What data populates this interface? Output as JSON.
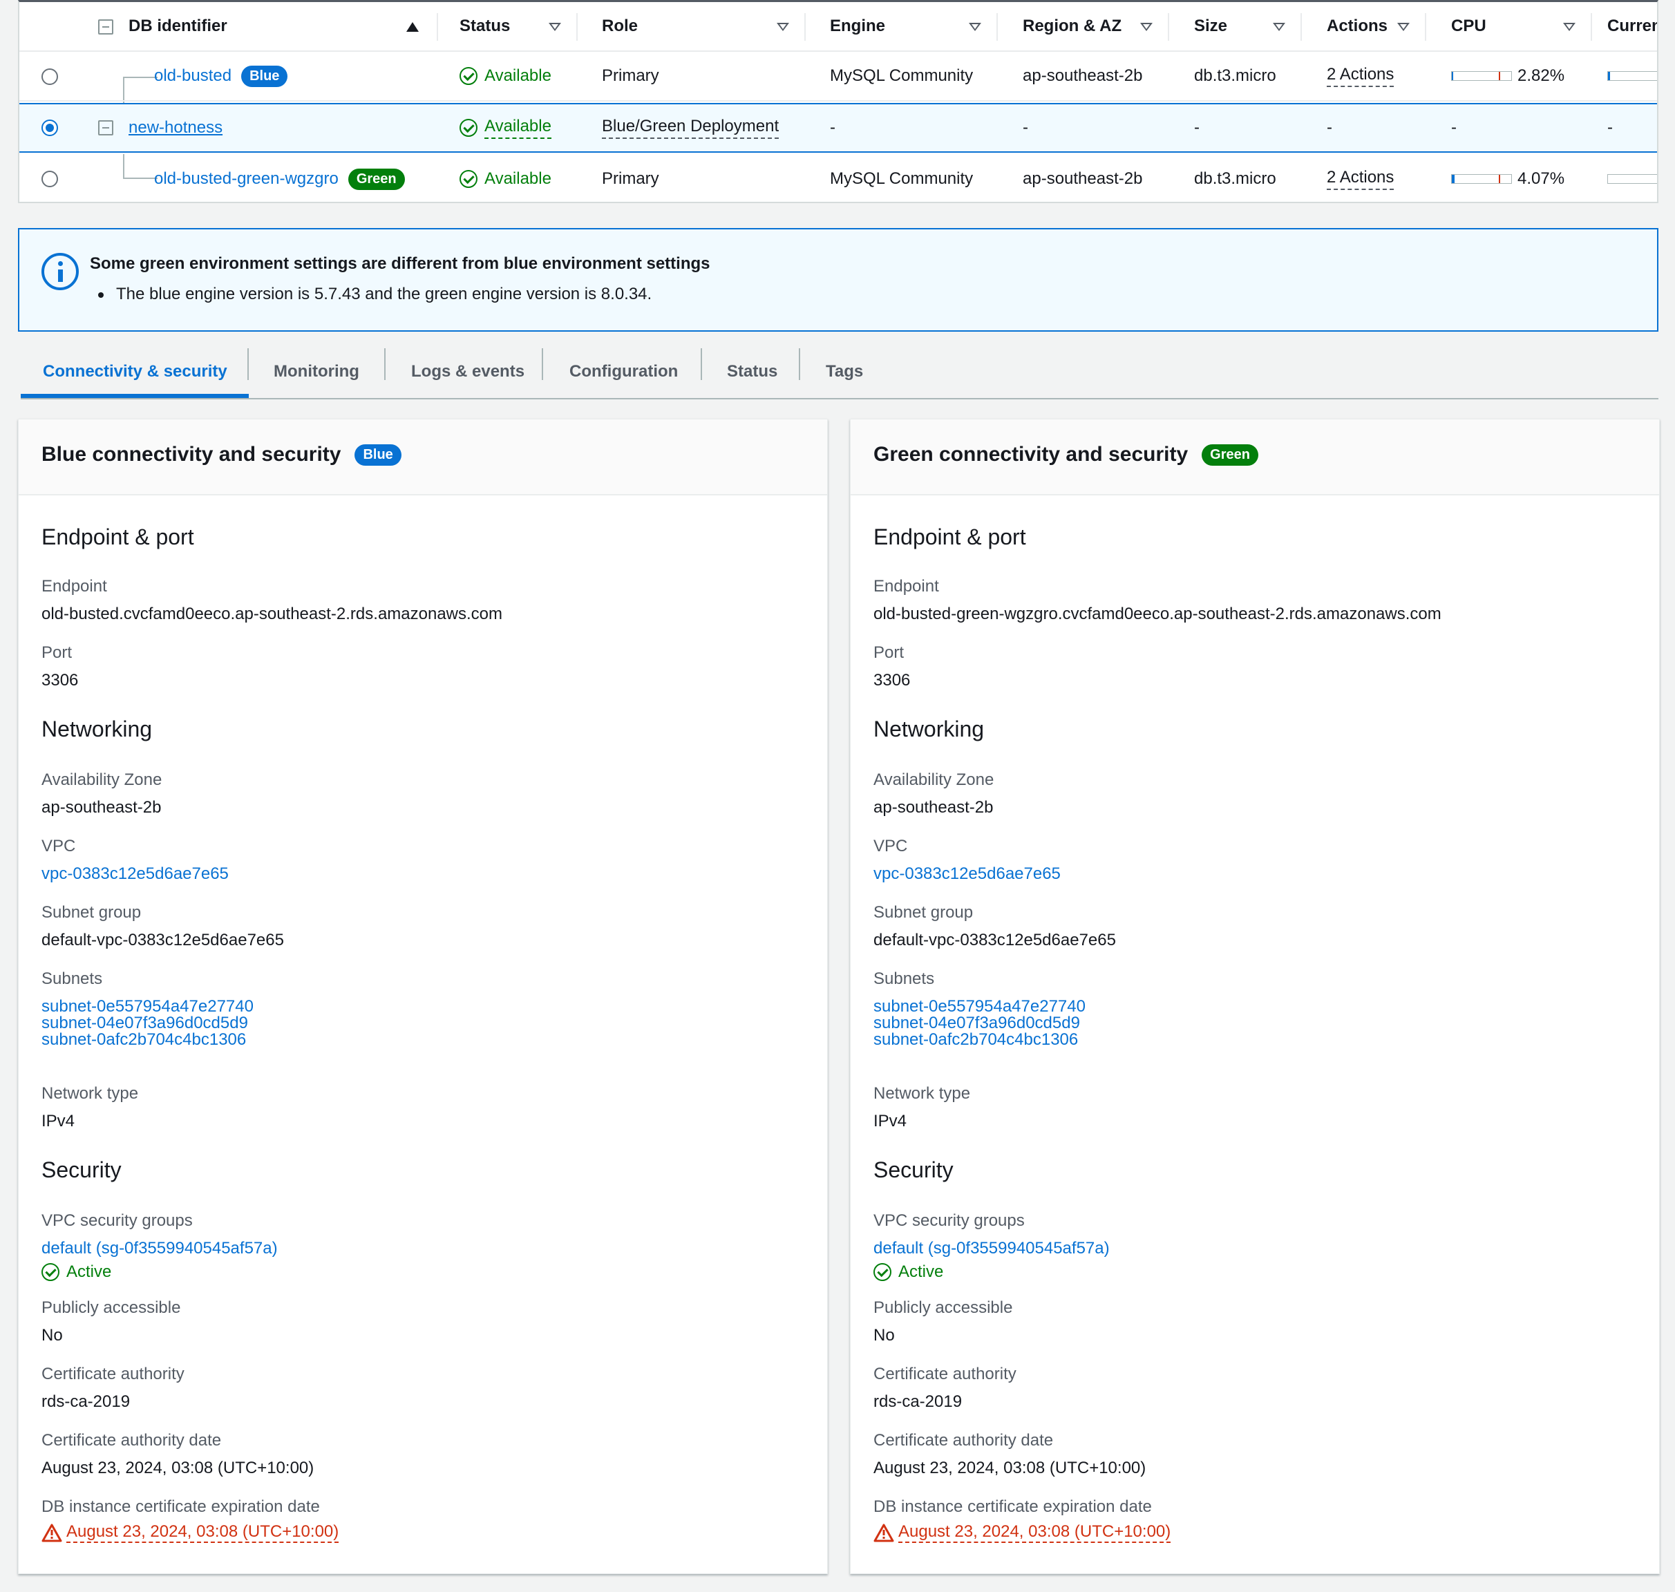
{
  "table": {
    "headers": {
      "db_identifier": "DB identifier",
      "status": "Status",
      "role": "Role",
      "engine": "Engine",
      "region": "Region & AZ",
      "size": "Size",
      "actions": "Actions",
      "cpu": "CPU",
      "current": "Curren"
    },
    "rows": [
      {
        "id": "old-busted",
        "badge": "Blue",
        "status": "Available",
        "role": "Primary",
        "engine": "MySQL Community",
        "region": "ap-southeast-2b",
        "size": "db.t3.micro",
        "actions": "2 Actions",
        "cpu": "2.82%",
        "cpu_fraction": 0.0282,
        "selected": false
      },
      {
        "id": "new-hotness",
        "status": "Available",
        "role": "Blue/Green Deployment",
        "engine": "-",
        "region": "-",
        "size": "-",
        "actions": "-",
        "cpu": "-",
        "current": "-",
        "selected": true
      },
      {
        "id": "old-busted-green-wgzgro",
        "badge": "Green",
        "status": "Available",
        "role": "Primary",
        "engine": "MySQL Community",
        "region": "ap-southeast-2b",
        "size": "db.t3.micro",
        "actions": "2 Actions",
        "cpu": "4.07%",
        "cpu_fraction": 0.0407,
        "selected": false
      }
    ]
  },
  "alert": {
    "title": "Some green environment settings are different from blue environment settings",
    "bullet": "The blue engine version is 5.7.43 and the green engine version is 8.0.34."
  },
  "tabs": [
    "Connectivity & security",
    "Monitoring",
    "Logs & events",
    "Configuration",
    "Status",
    "Tags"
  ],
  "panels": {
    "blue": {
      "title": "Blue connectivity and security",
      "badge": "Blue",
      "endpoint_port_h": "Endpoint & port",
      "endpoint_l": "Endpoint",
      "endpoint": "old-busted.cvcfamd0eeco.ap-southeast-2.rds.amazonaws.com",
      "port_l": "Port",
      "port": "3306",
      "networking_h": "Networking",
      "az_l": "Availability Zone",
      "az": "ap-southeast-2b",
      "vpc_l": "VPC",
      "vpc": "vpc-0383c12e5d6ae7e65",
      "subnet_group_l": "Subnet group",
      "subnet_group": "default-vpc-0383c12e5d6ae7e65",
      "subnets_l": "Subnets",
      "subnets": [
        "subnet-0e557954a47e27740",
        "subnet-04e07f3a96d0cd5d9",
        "subnet-0afc2b704c4bc1306"
      ],
      "network_type_l": "Network type",
      "network_type": "IPv4",
      "security_h": "Security",
      "sg_l": "VPC security groups",
      "sg": "default (sg-0f3559940545af57a)",
      "sg_status": "Active",
      "public_l": "Publicly accessible",
      "public": "No",
      "ca_l": "Certificate authority",
      "ca": "rds-ca-2019",
      "ca_date_l": "Certificate authority date",
      "ca_date": "August 23, 2024, 03:08 (UTC+10:00)",
      "expiry_l": "DB instance certificate expiration date",
      "expiry": "August 23, 2024, 03:08 (UTC+10:00)"
    },
    "green": {
      "title": "Green connectivity and security",
      "badge": "Green",
      "endpoint_port_h": "Endpoint & port",
      "endpoint_l": "Endpoint",
      "endpoint": "old-busted-green-wgzgro.cvcfamd0eeco.ap-southeast-2.rds.amazonaws.com",
      "port_l": "Port",
      "port": "3306",
      "networking_h": "Networking",
      "az_l": "Availability Zone",
      "az": "ap-southeast-2b",
      "vpc_l": "VPC",
      "vpc": "vpc-0383c12e5d6ae7e65",
      "subnet_group_l": "Subnet group",
      "subnet_group": "default-vpc-0383c12e5d6ae7e65",
      "subnets_l": "Subnets",
      "subnets": [
        "subnet-0e557954a47e27740",
        "subnet-04e07f3a96d0cd5d9",
        "subnet-0afc2b704c4bc1306"
      ],
      "network_type_l": "Network type",
      "network_type": "IPv4",
      "security_h": "Security",
      "sg_l": "VPC security groups",
      "sg": "default (sg-0f3559940545af57a)",
      "sg_status": "Active",
      "public_l": "Publicly accessible",
      "public": "No",
      "ca_l": "Certificate authority",
      "ca": "rds-ca-2019",
      "ca_date_l": "Certificate authority date",
      "ca_date": "August 23, 2024, 03:08 (UTC+10:00)",
      "expiry_l": "DB instance certificate expiration date",
      "expiry": "August 23, 2024, 03:08 (UTC+10:00)"
    }
  },
  "colors": {
    "accent": "#0972d3",
    "success": "#037f0c",
    "error": "#d13212",
    "blue_badge": "#0972d3",
    "green_badge": "#037f0c"
  }
}
